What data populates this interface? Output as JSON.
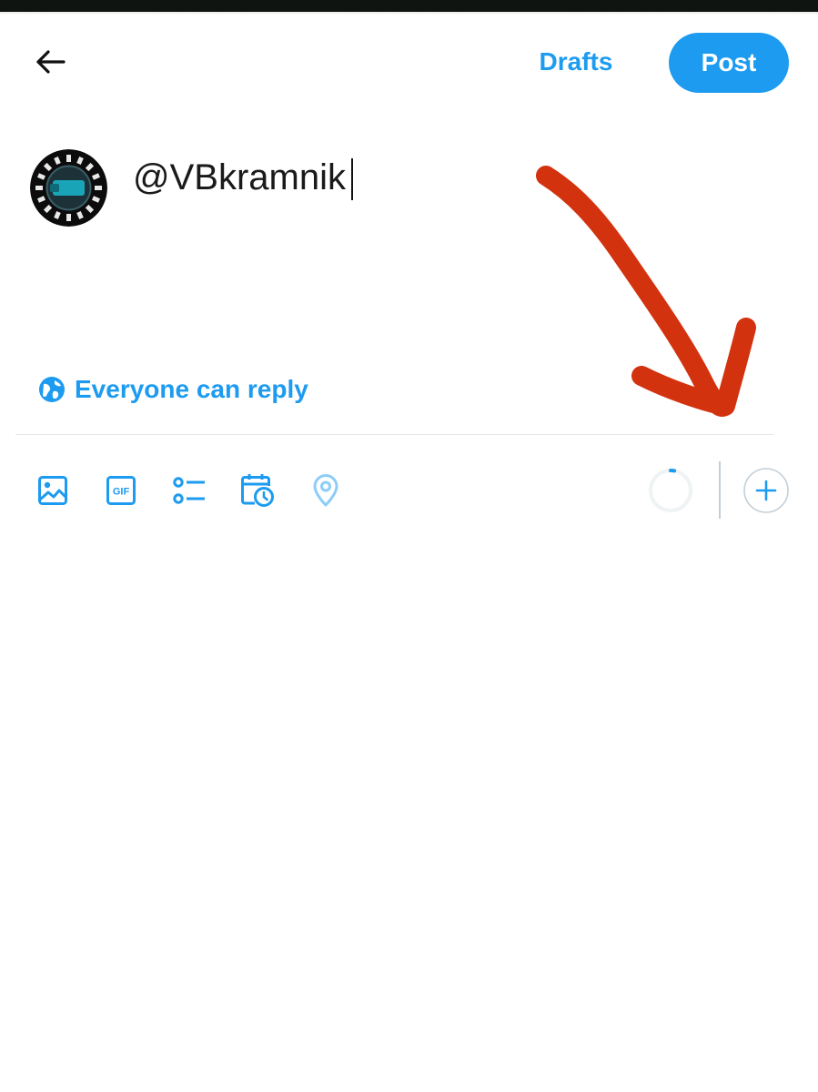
{
  "header": {
    "back_icon": "arrow-left-icon",
    "drafts_label": "Drafts",
    "post_label": "Post"
  },
  "compose": {
    "text": "@VBkramnik",
    "avatar_icon": "profile-avatar"
  },
  "reply_setting": {
    "icon": "globe-icon",
    "label": "Everyone can reply"
  },
  "toolbar": {
    "items": [
      {
        "icon": "image-icon"
      },
      {
        "icon": "gif-icon",
        "text": "GIF"
      },
      {
        "icon": "poll-icon"
      },
      {
        "icon": "schedule-icon"
      },
      {
        "icon": "location-icon"
      }
    ],
    "char_progress": 0.03,
    "add_icon": "plus-icon"
  },
  "annotation": {
    "color": "#d3320f",
    "icon": "arrow-annotation"
  },
  "colors": {
    "accent": "#1d9bf0",
    "accent_light": "#8ecdf7"
  }
}
